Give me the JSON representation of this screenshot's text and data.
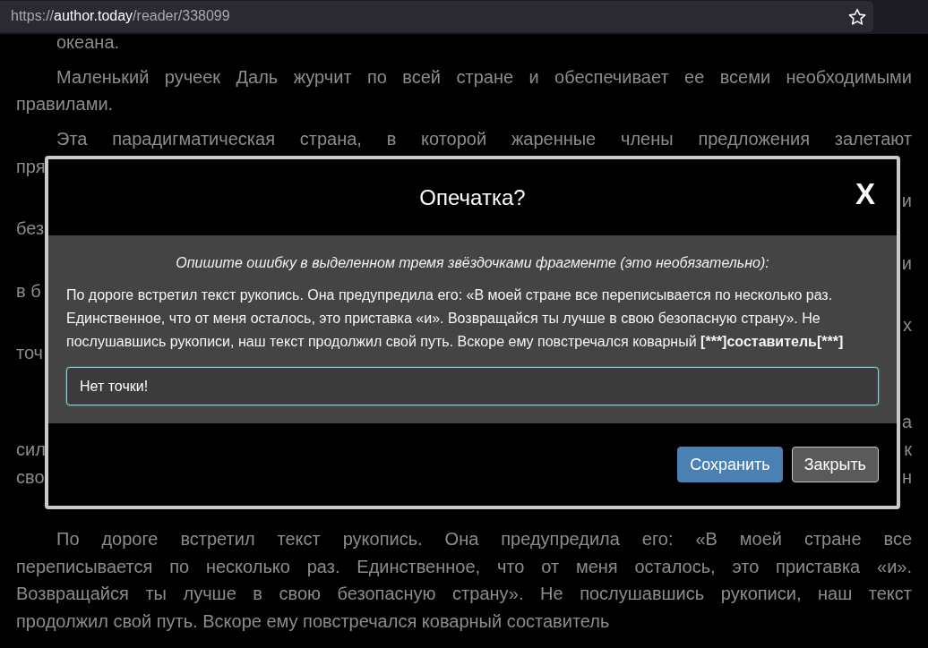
{
  "address_bar": {
    "scheme": "https://",
    "domain": "author.today",
    "path": "/reader/338099"
  },
  "article": {
    "paragraphs": [
      {
        "lines": [
          {
            "kind": "full",
            "text": "океана."
          }
        ]
      },
      {
        "lines": [
          {
            "kind": "full",
            "text": "Маленький ручеек Даль журчит по всей стране и обеспечивает ее всеми необходимыми"
          },
          {
            "kind": "full",
            "text": "правилами."
          }
        ]
      },
      {
        "lines": [
          {
            "kind": "full",
            "text": "Эта парадигматическая страна, в которой жаренные члены предложения залетают"
          },
          {
            "kind": "split",
            "left": "пря"
          }
        ]
      },
      {
        "lines": [
          {
            "kind": "split",
            "right": "и"
          },
          {
            "kind": "split",
            "left": "без"
          }
        ]
      },
      {
        "lines": [
          {
            "kind": "split",
            "right": "и"
          },
          {
            "kind": "split",
            "left": "в б"
          }
        ]
      },
      {
        "lines": [
          {
            "kind": "split",
            "right": "х"
          },
          {
            "kind": "split",
            "left": "точ"
          }
        ]
      },
      {
        "lines": [
          {
            "kind": "hidden"
          }
        ]
      },
      {
        "lines": [
          {
            "kind": "split",
            "right": "а"
          },
          {
            "kind": "split",
            "left": "сил",
            "right": "к"
          },
          {
            "kind": "split",
            "left": "сво",
            "right": "н"
          },
          {
            "kind": "hidden"
          }
        ]
      },
      {
        "lines": [
          {
            "kind": "full",
            "text": "По дороге встретил текст рукопись. Она предупредила его: «В моей стране все"
          },
          {
            "kind": "full",
            "text": "переписывается по несколько раз. Единственное, что от меня осталось, это приставка «и»."
          },
          {
            "kind": "full",
            "text": "Возвращайся ты лучше в свою безопасную страну». Не послушавшись рукописи, наш текст"
          },
          {
            "kind": "full",
            "text": "продолжил свой путь. Вскоре ему повстречался коварный составитель"
          }
        ]
      }
    ]
  },
  "dialog": {
    "title": "Опечатка?",
    "close": "X",
    "hint": "Опишите ошибку в выделенном тремя звёздочками фрагменте (это необязательно):",
    "fragment_text": "По дороге встретил текст рукопись. Она предупредила его: «В моей стране все переписывается по несколько раз. Единственное, что от меня осталось, это приставка «и». Возвращайся ты лучше в свою безопасную страну». Не послушавшись рукописи, наш текст продолжил свой путь. Вскоре ему повстречался коварный ",
    "marked_fragment": "[***]составитель[***]",
    "comment_value": "Нет точки!",
    "buttons": [
      {
        "label": "Сохранить",
        "kind": "primary"
      },
      {
        "label": "Закрыть",
        "kind": "secondary"
      }
    ]
  }
}
